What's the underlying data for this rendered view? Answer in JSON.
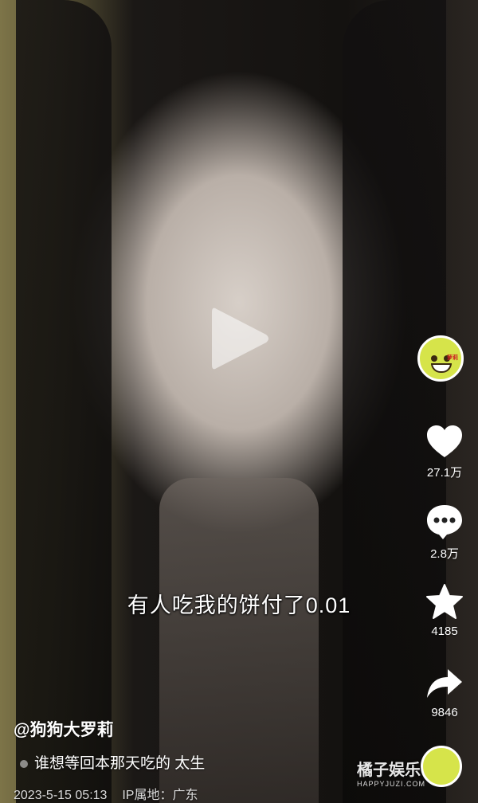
{
  "video": {
    "caption": "有人吃我的饼付了0.01"
  },
  "creator": {
    "avatar_tag": "萝莉",
    "handle": "@狗狗大罗莉",
    "description": "谁想等回本那天吃的 太生",
    "date": "2023-5-15 05:13",
    "ip_location": "IP属地：广东"
  },
  "actions": {
    "likes": "27.1万",
    "comments": "2.8万",
    "favorites": "4185",
    "shares": "9846"
  },
  "watermark": {
    "logo": "橘子娱乐",
    "url": "HAPPYJUZI.COM"
  },
  "icons": {
    "play": "play-icon",
    "like": "heart-icon",
    "comment": "comment-bubble-icon",
    "favorite": "star-icon",
    "share": "share-arrow-icon"
  }
}
